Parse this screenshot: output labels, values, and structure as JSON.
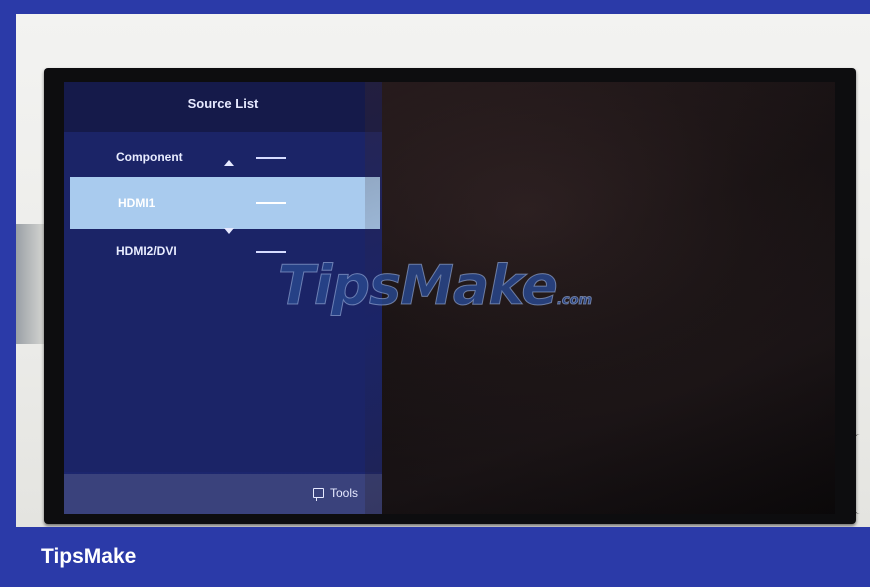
{
  "panel": {
    "title": "Source List",
    "items": [
      {
        "label": "Component",
        "selected": false
      },
      {
        "label": "HDMI1",
        "selected": true
      },
      {
        "label": "HDMI2/DVI",
        "selected": false
      }
    ],
    "footer": {
      "tools_label": "Tools",
      "tools_icon": "tools-icon"
    }
  },
  "watermark": {
    "main": "TipsMake",
    "suffix": ".com"
  },
  "caption": "TipsMake",
  "colors": {
    "frame": "#2b3aa8",
    "panel": "#1b2467",
    "selected_row": "#a9cbee",
    "footer": "#3a427c"
  }
}
